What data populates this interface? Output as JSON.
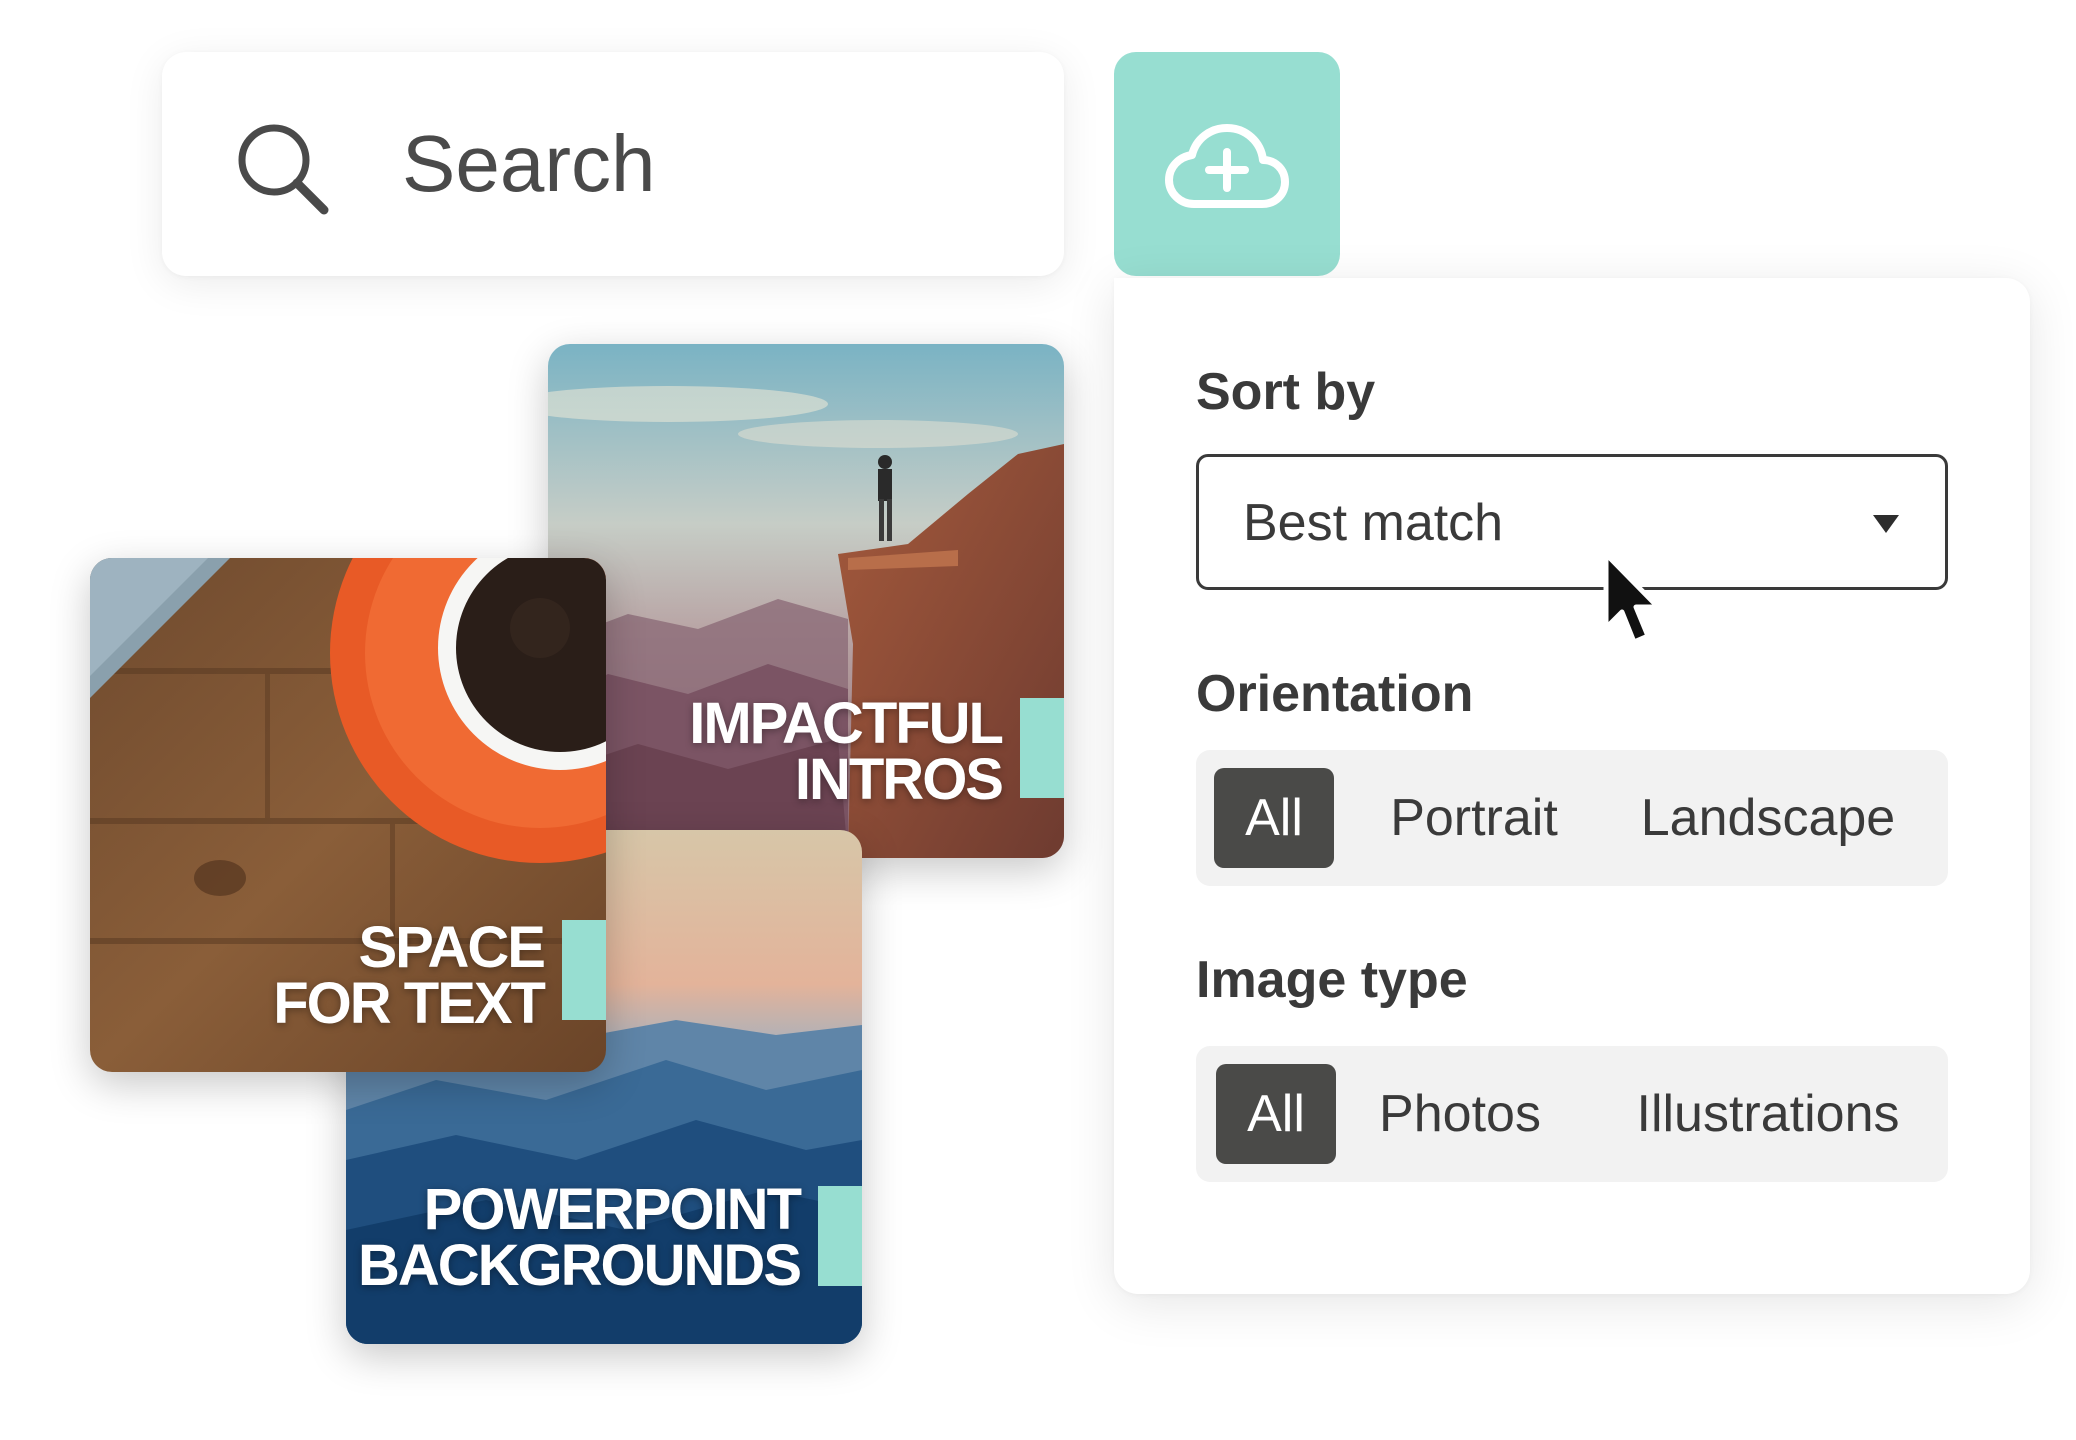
{
  "search": {
    "placeholder": "Search",
    "icon": "search-icon"
  },
  "upload": {
    "icon": "cloud-plus-icon",
    "color": "#97ded1"
  },
  "filters": {
    "sort": {
      "label": "Sort by",
      "selected": "Best match"
    },
    "orientation": {
      "label": "Orientation",
      "options": [
        "All",
        "Portrait",
        "Landscape"
      ],
      "selected": "All"
    },
    "image_type": {
      "label": "Image type",
      "options": [
        "All",
        "Photos",
        "Illustrations"
      ],
      "selected": "All"
    }
  },
  "cards": {
    "intros": {
      "line1": "IMPACTFUL",
      "line2": "INTROS"
    },
    "space": {
      "line1": "SPACE",
      "line2": "FOR TEXT"
    },
    "backgrounds": {
      "line1": "POWERPOINT",
      "line2": "BACKGROUNDS"
    }
  },
  "colors": {
    "accent": "#97ded1",
    "active_segment": "#4a4a48",
    "text": "#3a3a3a"
  }
}
